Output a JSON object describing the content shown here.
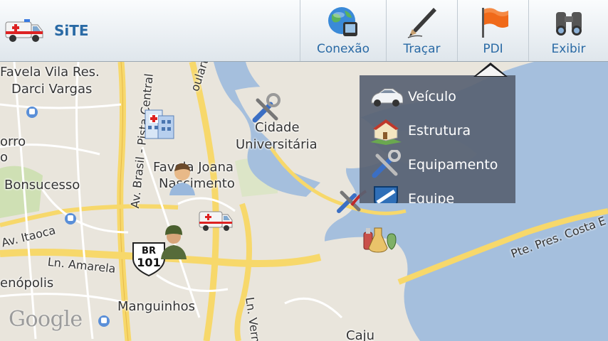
{
  "app": {
    "title": "SiTE",
    "logo_icon": "ambulance-icon"
  },
  "toolbar": {
    "actions": [
      {
        "label": "Conexão",
        "icon": "globe-device-icon"
      },
      {
        "label": "Traçar",
        "icon": "pencil-icon"
      },
      {
        "label": "PDI",
        "icon": "flag-icon"
      },
      {
        "label": "Exibir",
        "icon": "binoculars-icon"
      }
    ]
  },
  "pdi_menu": {
    "items": [
      {
        "label": "Veículo",
        "icon": "car-icon"
      },
      {
        "label": "Estrutura",
        "icon": "building-icon"
      },
      {
        "label": "Equipamento",
        "icon": "tools-icon"
      },
      {
        "label": "Equipe",
        "icon": "shield-icon"
      }
    ]
  },
  "map": {
    "places": {
      "favela_vila_line1": "Favela Vila Res.",
      "favela_vila_line2": "Darci Vargas",
      "morro_line1": "orro",
      "morro_line2": "o",
      "bonsucesso": "Bonsucesso",
      "favela_joana_line1": "Favela Joana",
      "favela_joana_line2": "Nascimento",
      "cidade_line1": "Cidade",
      "cidade_line2": "Universitária",
      "penopolis": "enópolis",
      "manguinhos": "Manguinhos",
      "caju": "Caju"
    },
    "roads": {
      "av_brasil": "Av. Brasil - Pista Central",
      "av_itaoca": "Av. Itaoca",
      "ln_amarela": "Ln. Amarela",
      "ln_vermelha": "Ln. Verm",
      "pte_costa": "Pte. Pres. Costa E",
      "boulevard": "oulart"
    },
    "highway_shield": {
      "top": "BR",
      "bottom": "101"
    },
    "attribution": "Google",
    "markers": [
      "hospital-icon",
      "tools-icon",
      "user-icon",
      "soldier-icon",
      "ambulance-icon",
      "tools-vehicle-icon",
      "chemicals-icon"
    ]
  },
  "colors": {
    "land": "#e9e5dc",
    "water": "#a5bfdd",
    "highway": "#f7d86b",
    "accent": "#2a6aa5"
  }
}
